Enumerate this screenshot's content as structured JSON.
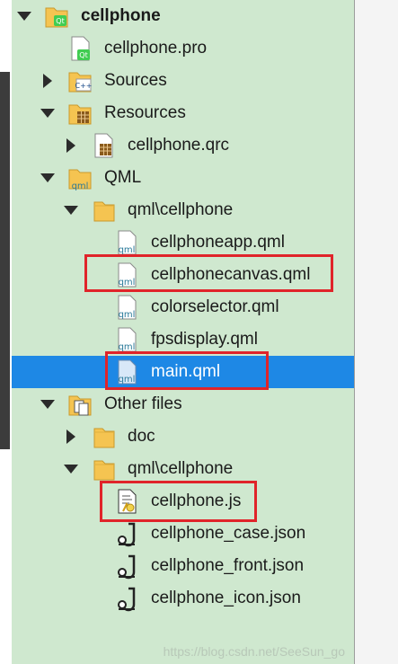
{
  "tree": {
    "project": {
      "label": "cellphone",
      "icon": "qt-project-folder-icon"
    },
    "pro_file": {
      "label": "cellphone.pro",
      "icon": "qt-pro-file-icon"
    },
    "sources": {
      "label": "Sources",
      "icon": "cpp-folder-icon"
    },
    "resources": {
      "label": "Resources",
      "icon": "resources-folder-icon"
    },
    "qrc_file": {
      "label": "cellphone.qrc",
      "icon": "qrc-file-icon"
    },
    "qml_group": {
      "label": "QML",
      "icon": "qml-folder-icon"
    },
    "qml_folder": {
      "label": "qml\\cellphone",
      "icon": "folder-icon"
    },
    "qml_files": [
      {
        "label": "cellphoneapp.qml",
        "icon": "qml-file-icon"
      },
      {
        "label": "cellphonecanvas.qml",
        "icon": "qml-file-icon",
        "highlighted": true
      },
      {
        "label": "colorselector.qml",
        "icon": "qml-file-icon"
      },
      {
        "label": "fpsdisplay.qml",
        "icon": "qml-file-icon"
      },
      {
        "label": "main.qml",
        "icon": "qml-file-icon",
        "selected": true,
        "highlighted": true
      }
    ],
    "other_files": {
      "label": "Other files",
      "icon": "other-files-icon"
    },
    "doc_folder": {
      "label": "doc",
      "icon": "folder-icon"
    },
    "other_qml_folder": {
      "label": "qml\\cellphone",
      "icon": "folder-icon"
    },
    "other_files_list": [
      {
        "label": "cellphone.js",
        "icon": "js-file-icon",
        "highlighted": true
      },
      {
        "label": "cellphone_case.json",
        "icon": "json-file-icon"
      },
      {
        "label": "cellphone_front.json",
        "icon": "json-file-icon"
      },
      {
        "label": "cellphone_icon.json",
        "icon": "json-file-icon"
      }
    ]
  },
  "colors": {
    "tree_background": "#cfe8cf",
    "selection": "#1e88e5",
    "highlight_box": "#e0242a",
    "folder": "#f5c451"
  },
  "watermark": "https://blog.csdn.net/SeeSun_go"
}
